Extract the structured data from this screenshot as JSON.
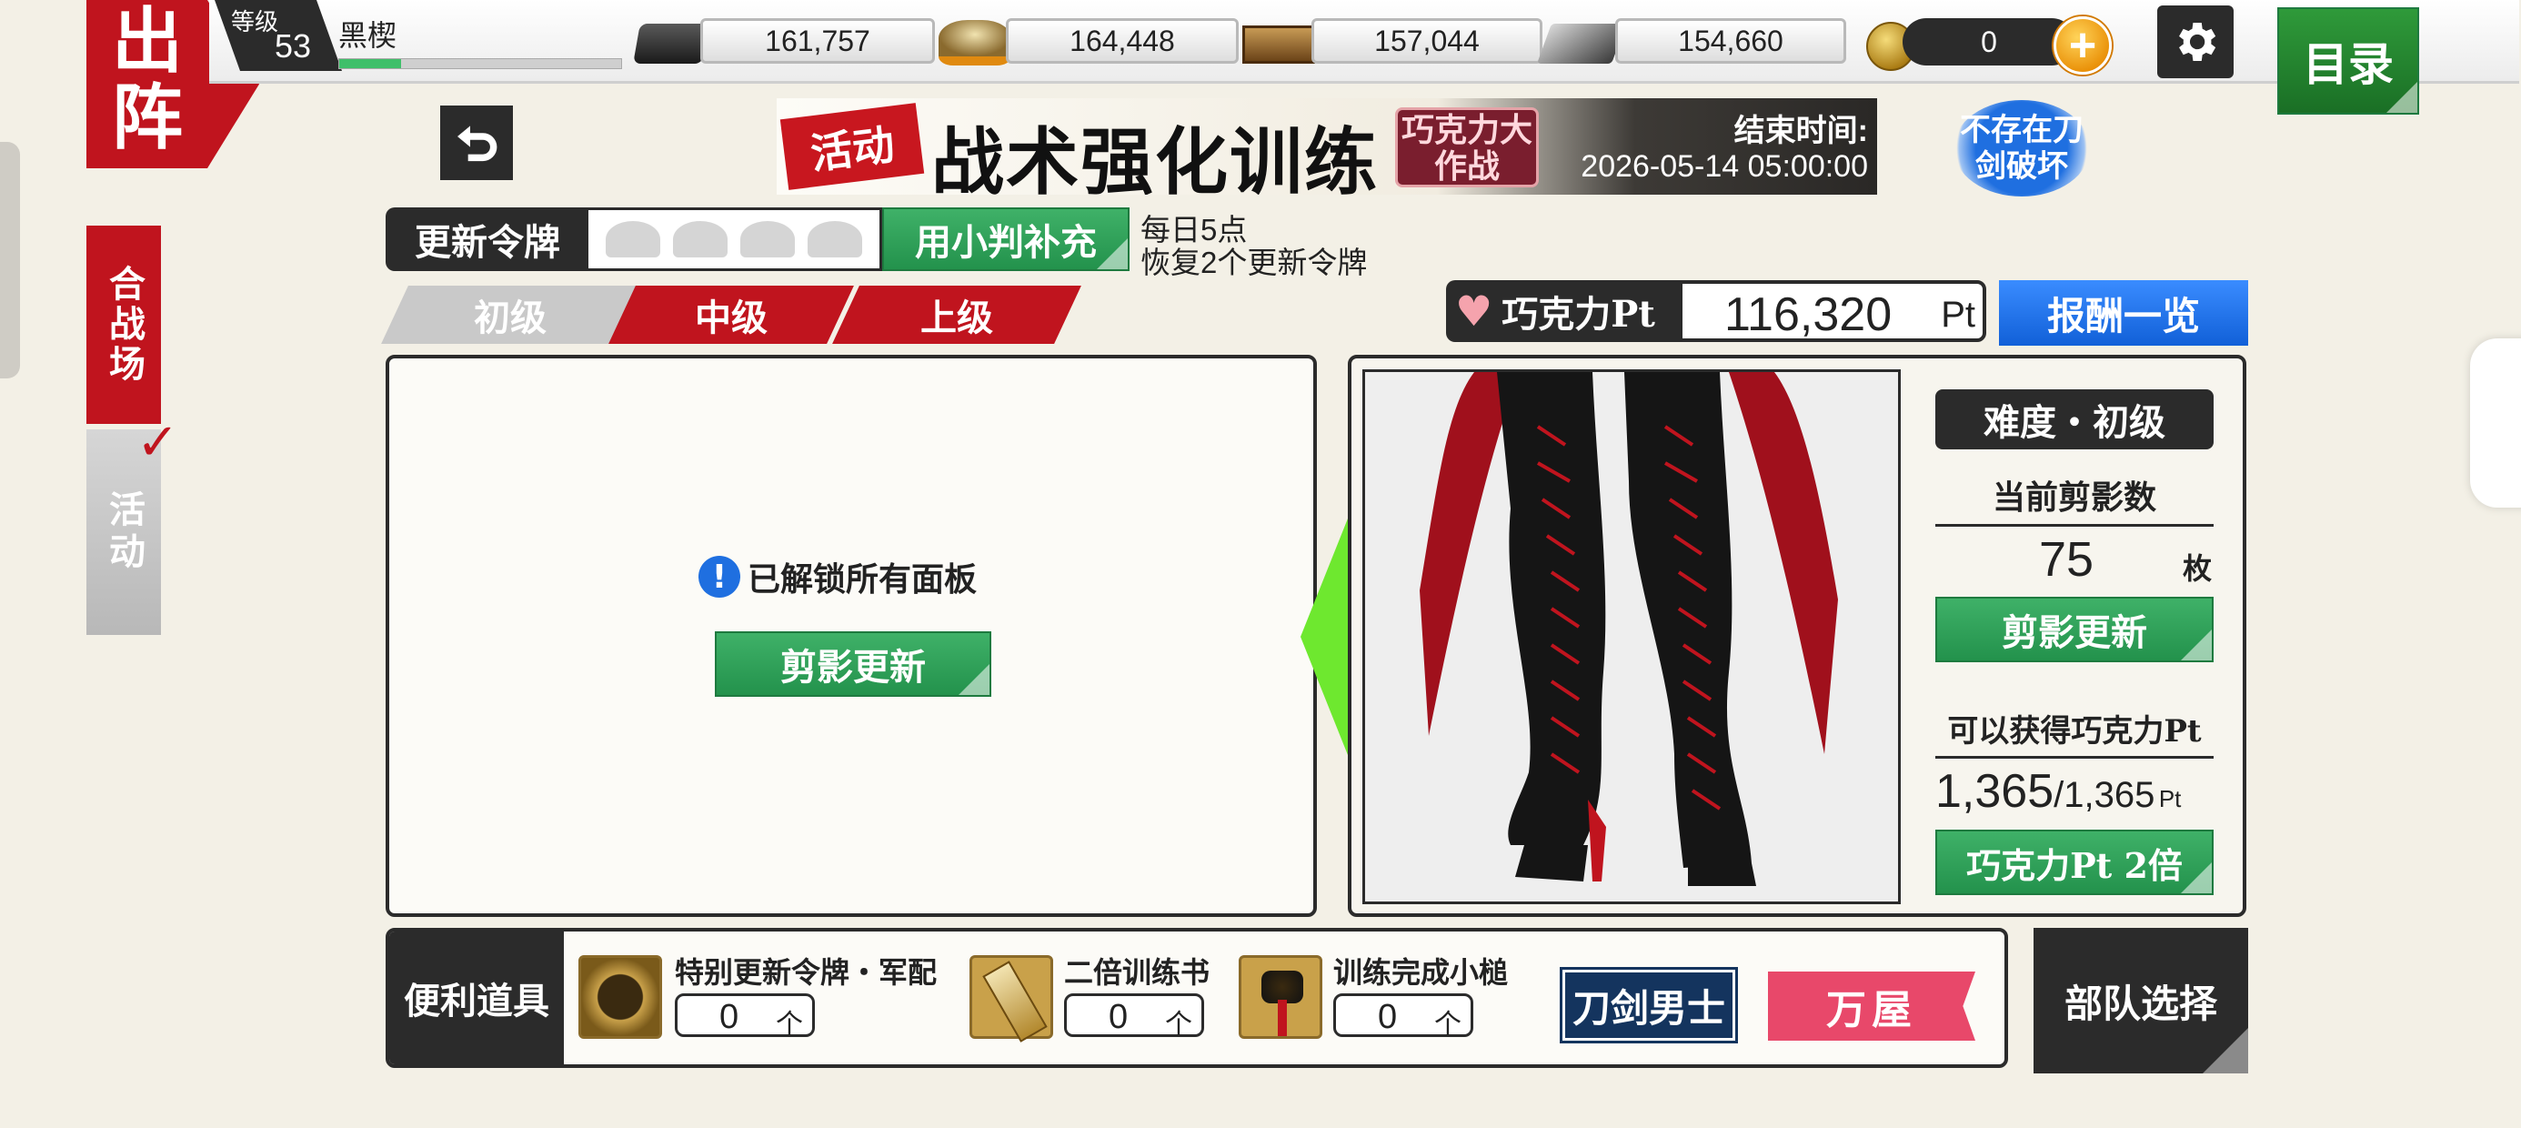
{
  "header": {
    "level_label": "等级",
    "level": "53",
    "player_name": "黑楔",
    "resources": [
      {
        "icon": "charcoal-icon",
        "value": "161,757"
      },
      {
        "icon": "whetstone-icon",
        "value": "164,448"
      },
      {
        "icon": "cold-steel-icon",
        "value": "157,044"
      },
      {
        "icon": "balls-of-steel-icon",
        "value": "154,660"
      }
    ],
    "coins": "0",
    "menu_label": "目录"
  },
  "side": {
    "main_title": "出阵",
    "tab_battle": "合战场",
    "tab_event": "活动"
  },
  "event_banner": {
    "tag": "活动",
    "title": "战术强化训练",
    "sub_title": "巧克力大作战",
    "end_label": "结束时间:",
    "end_time": "2026-05-14 05:00:00"
  },
  "badge_no_break": "不存在刀剑破坏",
  "tokens": {
    "label": "更新令牌",
    "refill_button": "用小判补充",
    "note_line1": "每日5点",
    "note_line2": "恢复2个更新令牌"
  },
  "tiers": [
    "初级",
    "中级",
    "上级"
  ],
  "chocolate_pt": {
    "label": "巧克力Pt",
    "value": "116,320",
    "unit": "Pt",
    "rewards_button": "报酬一览"
  },
  "left_panel": {
    "message": "已解锁所有面板",
    "refresh_button": "剪影更新"
  },
  "right_panel": {
    "difficulty": "难度・初级",
    "silhouettes_label": "当前剪影数",
    "silhouettes_value": "75",
    "silhouettes_unit": "枚",
    "refresh_button": "剪影更新",
    "obtainable_label": "可以获得巧克力Pt",
    "obtainable_current": "1,365",
    "obtainable_max": "/1,365",
    "obtainable_unit": "Pt",
    "double_button": "巧克力Pt 2倍"
  },
  "items_bar": {
    "label": "便利道具",
    "items": [
      {
        "name": "特别更新令牌・军配",
        "count": "0",
        "unit": "个"
      },
      {
        "name": "二倍训练书",
        "count": "0",
        "unit": "个"
      },
      {
        "name": "训练完成小槌",
        "count": "0",
        "unit": "个"
      }
    ],
    "touken_button": "刀剑男士",
    "yorozuya_button": "万屋"
  },
  "squad_button": "部队选择",
  "colors": {
    "red": "#c0141e",
    "green": "#2f9e57",
    "blue": "#1f6fe0",
    "dark": "#2b2b2b"
  }
}
